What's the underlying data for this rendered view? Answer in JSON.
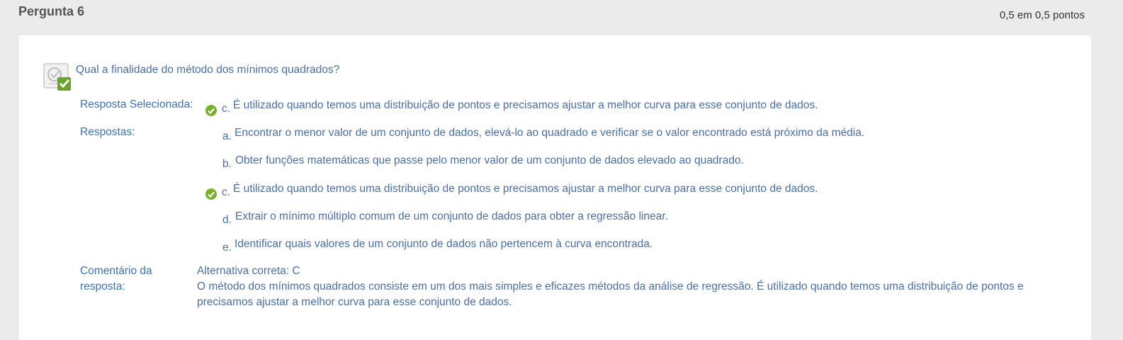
{
  "question": {
    "title": "Pergunta 6",
    "points": "0,5 em 0,5 pontos",
    "icon": "correct-question-icon",
    "text": "Qual a finalidade do método dos mínimos quadrados?"
  },
  "selected": {
    "label": "Resposta Selecionada:",
    "letter": "c.",
    "text": "É utilizado quando temos uma distribuição de pontos e precisamos ajustar a melhor curva para esse conjunto de dados."
  },
  "answers": {
    "label": "Respostas:",
    "options": [
      {
        "letter": "a.",
        "text": "Encontrar o menor valor de um conjunto de dados, elevá-lo ao quadrado e verificar se o valor encontrado está próximo da média."
      },
      {
        "letter": "b.",
        "text": "Obter funções matemáticas que passe pelo menor valor de um conjunto de dados elevado ao quadrado."
      },
      {
        "letter": "c.",
        "text": "É utilizado quando temos uma distribuição de pontos e precisamos ajustar a melhor curva para esse conjunto de dados."
      },
      {
        "letter": "d.",
        "text": "Extrair o mínimo múltiplo comum de um conjunto de dados para obter a regressão linear."
      },
      {
        "letter": "e.",
        "text": "Identificar quais valores de um conjunto de dados não pertencem à curva encontrada."
      }
    ]
  },
  "comment": {
    "label_line1": "Comentário da",
    "label_line2": "resposta:",
    "correct": "Alternativa correta: C",
    "body": "O método dos mínimos quadrados consiste em um dos mais simples e eficazes métodos da análise de regressão. É utilizado quando temos uma distribuição de pontos e precisamos ajustar a melhor curva para esse conjunto de dados."
  },
  "colors": {
    "accent": "#4a6fa5",
    "check": "#7ab12c",
    "background": "#ebebeb"
  }
}
